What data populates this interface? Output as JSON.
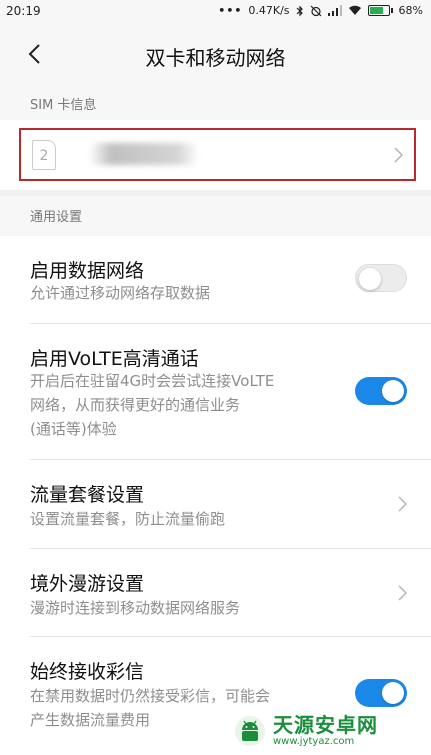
{
  "status_bar": {
    "time": "20:19",
    "dots": "•••",
    "speed": "0.47K/s",
    "battery": "68%",
    "battery_level": 0.68
  },
  "header": {
    "title": "双卡和移动网络"
  },
  "sim_section": {
    "label": "SIM 卡信息",
    "sim_slot_number": "2"
  },
  "general_section": {
    "label": "通用设置"
  },
  "settings": {
    "data_network": {
      "title": "启用数据网络",
      "subtitle": "允许通过移动网络存取数据",
      "enabled": false
    },
    "volte": {
      "title": "启用VoLTE高清通话",
      "subtitle_line1": "开启后在驻留4G时会尝试连接VoLTE",
      "subtitle_line2": "网络，从而获得更好的通信业务",
      "subtitle_line3": "(通话等)体验",
      "enabled": true
    },
    "data_plan": {
      "title": "流量套餐设置",
      "subtitle": "设置流量套餐，防止流量偷跑"
    },
    "roaming": {
      "title": "境外漫游设置",
      "subtitle": "漫游时连接到移动数据网络服务"
    },
    "mms": {
      "title": "始终接收彩信",
      "subtitle_line1": "在禁用数据时仍然接受彩信，可能会",
      "subtitle_line2": "产生数据流量费用",
      "enabled": true
    }
  },
  "watermark": {
    "name": "天源安卓网",
    "url": "www.jytyaz.com"
  },
  "colors": {
    "accent": "#1a88e8",
    "highlight_border": "#b92a2a",
    "watermark_green": "#1a8e3a"
  }
}
